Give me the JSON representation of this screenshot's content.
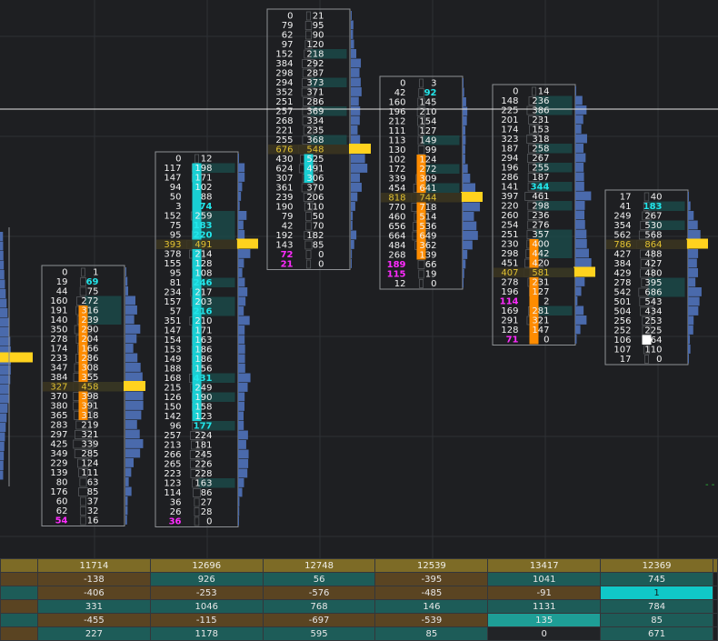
{
  "chart_data": {
    "type": "footprint",
    "crosshair": "horizontal",
    "bars": [
      {
        "rows": [
          [
            0,
            1
          ],
          [
            19,
            69
          ],
          [
            44,
            75
          ],
          [
            160,
            272
          ],
          [
            191,
            316
          ],
          [
            140,
            239
          ],
          [
            350,
            290
          ],
          [
            278,
            204
          ],
          [
            174,
            166
          ],
          [
            233,
            286
          ],
          [
            347,
            308
          ],
          [
            384,
            355
          ],
          [
            327,
            458
          ],
          [
            370,
            398
          ],
          [
            380,
            391
          ],
          [
            365,
            318
          ],
          [
            283,
            219
          ],
          [
            297,
            321
          ],
          [
            425,
            339
          ],
          [
            349,
            285
          ],
          [
            229,
            124
          ],
          [
            139,
            111
          ],
          [
            80,
            63
          ],
          [
            176,
            85
          ],
          [
            60,
            37
          ],
          [
            62,
            32
          ],
          [
            54,
            16
          ]
        ],
        "poc_index": 12,
        "body": [
          4,
          15
        ],
        "body_color": "#ff8c00"
      },
      {
        "rows": [
          [
            0,
            12
          ],
          [
            117,
            198
          ],
          [
            147,
            171
          ],
          [
            94,
            102
          ],
          [
            50,
            88
          ],
          [
            3,
            74
          ],
          [
            152,
            259
          ],
          [
            75,
            183
          ],
          [
            95,
            220
          ],
          [
            393,
            491
          ],
          [
            378,
            214
          ],
          [
            155,
            128
          ],
          [
            95,
            108
          ],
          [
            81,
            246
          ],
          [
            234,
            217
          ],
          [
            157,
            203
          ],
          [
            57,
            216
          ],
          [
            351,
            210
          ],
          [
            147,
            171
          ],
          [
            154,
            163
          ],
          [
            153,
            186
          ],
          [
            149,
            186
          ],
          [
            188,
            156
          ],
          [
            168,
            431
          ],
          [
            215,
            249
          ],
          [
            126,
            190
          ],
          [
            150,
            158
          ],
          [
            142,
            123
          ],
          [
            96,
            177
          ],
          [
            257,
            224
          ],
          [
            213,
            181
          ],
          [
            266,
            245
          ],
          [
            265,
            226
          ],
          [
            223,
            228
          ],
          [
            123,
            163
          ],
          [
            114,
            86
          ],
          [
            36,
            27
          ],
          [
            26,
            28
          ],
          [
            36,
            0
          ]
        ],
        "poc_index": 9,
        "body": [
          1,
          27
        ],
        "body_color": "#19cfd3"
      },
      {
        "rows": [
          [
            0,
            21
          ],
          [
            79,
            95
          ],
          [
            62,
            90
          ],
          [
            97,
            120
          ],
          [
            152,
            218
          ],
          [
            384,
            292
          ],
          [
            298,
            287
          ],
          [
            294,
            373
          ],
          [
            352,
            371
          ],
          [
            251,
            286
          ],
          [
            257,
            369
          ],
          [
            268,
            334
          ],
          [
            221,
            235
          ],
          [
            255,
            368
          ],
          [
            676,
            548
          ],
          [
            430,
            525
          ],
          [
            624,
            491
          ],
          [
            307,
            306
          ],
          [
            361,
            370
          ],
          [
            239,
            206
          ],
          [
            190,
            110
          ],
          [
            79,
            50
          ],
          [
            42,
            70
          ],
          [
            192,
            182
          ],
          [
            143,
            85
          ],
          [
            72,
            0
          ],
          [
            21,
            0
          ]
        ],
        "poc_index": 14,
        "body": [
          15,
          17
        ],
        "body_color": "#19cfd3"
      },
      {
        "rows": [
          [
            0,
            3
          ],
          [
            42,
            92
          ],
          [
            160,
            145
          ],
          [
            196,
            210
          ],
          [
            212,
            154
          ],
          [
            111,
            127
          ],
          [
            113,
            149
          ],
          [
            130,
            99
          ],
          [
            102,
            124
          ],
          [
            172,
            272
          ],
          [
            339,
            309
          ],
          [
            454,
            641
          ],
          [
            818,
            744
          ],
          [
            770,
            718
          ],
          [
            460,
            514
          ],
          [
            656,
            536
          ],
          [
            664,
            649
          ],
          [
            484,
            362
          ],
          [
            268,
            139
          ],
          [
            189,
            66
          ],
          [
            115,
            19
          ],
          [
            12,
            0
          ]
        ],
        "poc_index": 12,
        "body": [
          8,
          18
        ],
        "body_color": "#ff8c00"
      },
      {
        "rows": [
          [
            0,
            14
          ],
          [
            148,
            236
          ],
          [
            225,
            386
          ],
          [
            201,
            231
          ],
          [
            174,
            153
          ],
          [
            323,
            318
          ],
          [
            187,
            258
          ],
          [
            294,
            267
          ],
          [
            196,
            255
          ],
          [
            286,
            187
          ],
          [
            141,
            344
          ],
          [
            397,
            461
          ],
          [
            220,
            298
          ],
          [
            260,
            236
          ],
          [
            254,
            276
          ],
          [
            251,
            357
          ],
          [
            230,
            400
          ],
          [
            298,
            442
          ],
          [
            451,
            420
          ],
          [
            407,
            581
          ],
          [
            278,
            231
          ],
          [
            196,
            127
          ],
          [
            114,
            2
          ],
          [
            169,
            281
          ],
          [
            291,
            321
          ],
          [
            128,
            147
          ],
          [
            71,
            0
          ]
        ],
        "poc_index": 19,
        "body": [
          16,
          26
        ],
        "body_color": "#ff8c00"
      },
      {
        "rows": [
          [
            17,
            40
          ],
          [
            41,
            183
          ],
          [
            249,
            267
          ],
          [
            354,
            530
          ],
          [
            562,
            568
          ],
          [
            786,
            864
          ],
          [
            427,
            488
          ],
          [
            384,
            427
          ],
          [
            429,
            480
          ],
          [
            278,
            395
          ],
          [
            542,
            686
          ],
          [
            501,
            543
          ],
          [
            504,
            434
          ],
          [
            256,
            253
          ],
          [
            252,
            225
          ],
          [
            106,
            64
          ],
          [
            107,
            110
          ],
          [
            17,
            0
          ]
        ],
        "poc_index": 5,
        "body": [
          15,
          15
        ],
        "body_color": "#ffffff"
      }
    ]
  },
  "stats": {
    "rows": [
      {
        "name": "volume",
        "values": [
          "11714",
          "12696",
          "12748",
          "12539",
          "13417",
          "12369"
        ]
      },
      {
        "name": "delta",
        "values": [
          "-138",
          "926",
          "56",
          "-395",
          "1041",
          "745"
        ]
      },
      {
        "name": "delta2",
        "values": [
          "-406",
          "-253",
          "-576",
          "-485",
          "-91",
          "1"
        ]
      },
      {
        "name": "delta3",
        "values": [
          "331",
          "1046",
          "768",
          "146",
          "1131",
          "784"
        ]
      },
      {
        "name": "delta4",
        "values": [
          "-455",
          "-115",
          "-697",
          "-539",
          "135",
          "85"
        ]
      },
      {
        "name": "delta5",
        "values": [
          "227",
          "1178",
          "595",
          "85",
          "0",
          "671"
        ]
      }
    ]
  },
  "colors": {
    "background": "#1e1f22",
    "grid": "#2e3034",
    "profile": "#4a6aac",
    "poc": "#ffd21e",
    "large_bid": "#ff2bff",
    "large_ask": "#22e6ea",
    "poc_text": "#e2c232",
    "cell_text": "#f2f2f2",
    "box_border": "#8d9094"
  }
}
